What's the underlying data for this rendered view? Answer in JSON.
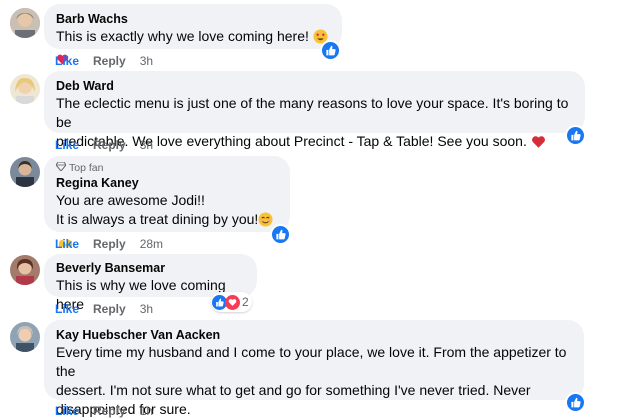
{
  "comments": [
    {
      "author": "Barb Wachs",
      "text": "This is exactly why we love coming here!",
      "like": "Like",
      "reply": "Reply",
      "time": "3h",
      "emojis": [
        "heart-eyes-icon",
        "heart-icon"
      ],
      "reactions": [
        "like"
      ]
    },
    {
      "author": "Deb Ward",
      "text_line1": "The eclectic menu is just one of the many reasons to love your space. It's boring to be",
      "text_line2": "predictable. We love everything about Precinct - Tap & Table! See you soon.",
      "like": "Like",
      "reply": "Reply",
      "time": "3h",
      "emojis": [
        "red-heart-icon"
      ],
      "reactions": [
        "like"
      ]
    },
    {
      "badge": "Top fan",
      "author": "Regina Kaney",
      "text_line1": "You are awesome Jodi!!",
      "text_line2": "It is always a treat dining by you!",
      "like": "Like",
      "reply": "Reply",
      "time": "28m",
      "emojis": [
        "smiling-face-icon",
        "heart-hands-icon"
      ],
      "reactions": [
        "like"
      ]
    },
    {
      "author": "Beverly Bansemar",
      "text": "This is why we love coming here",
      "like": "Like",
      "reply": "Reply",
      "time": "3h",
      "reactions": [
        "like",
        "love"
      ],
      "reaction_count": "2"
    },
    {
      "author": "Kay Huebscher Van Aacken",
      "text_line1": "Every time my husband and I come to your place, we love it. From the appetizer to the",
      "text_line2": "dessert. I'm not sure what to get and go for something I've never tried. Never",
      "text_line3": "disappointed for sure.",
      "like": "Like",
      "reply": "Reply",
      "time": "1h",
      "reactions": [
        "like"
      ]
    }
  ],
  "colors": {
    "like_blue": "#1877f2",
    "bubble_bg": "#f0f2f5",
    "meta_gray": "#65676b",
    "love_red": "#f33e58"
  }
}
